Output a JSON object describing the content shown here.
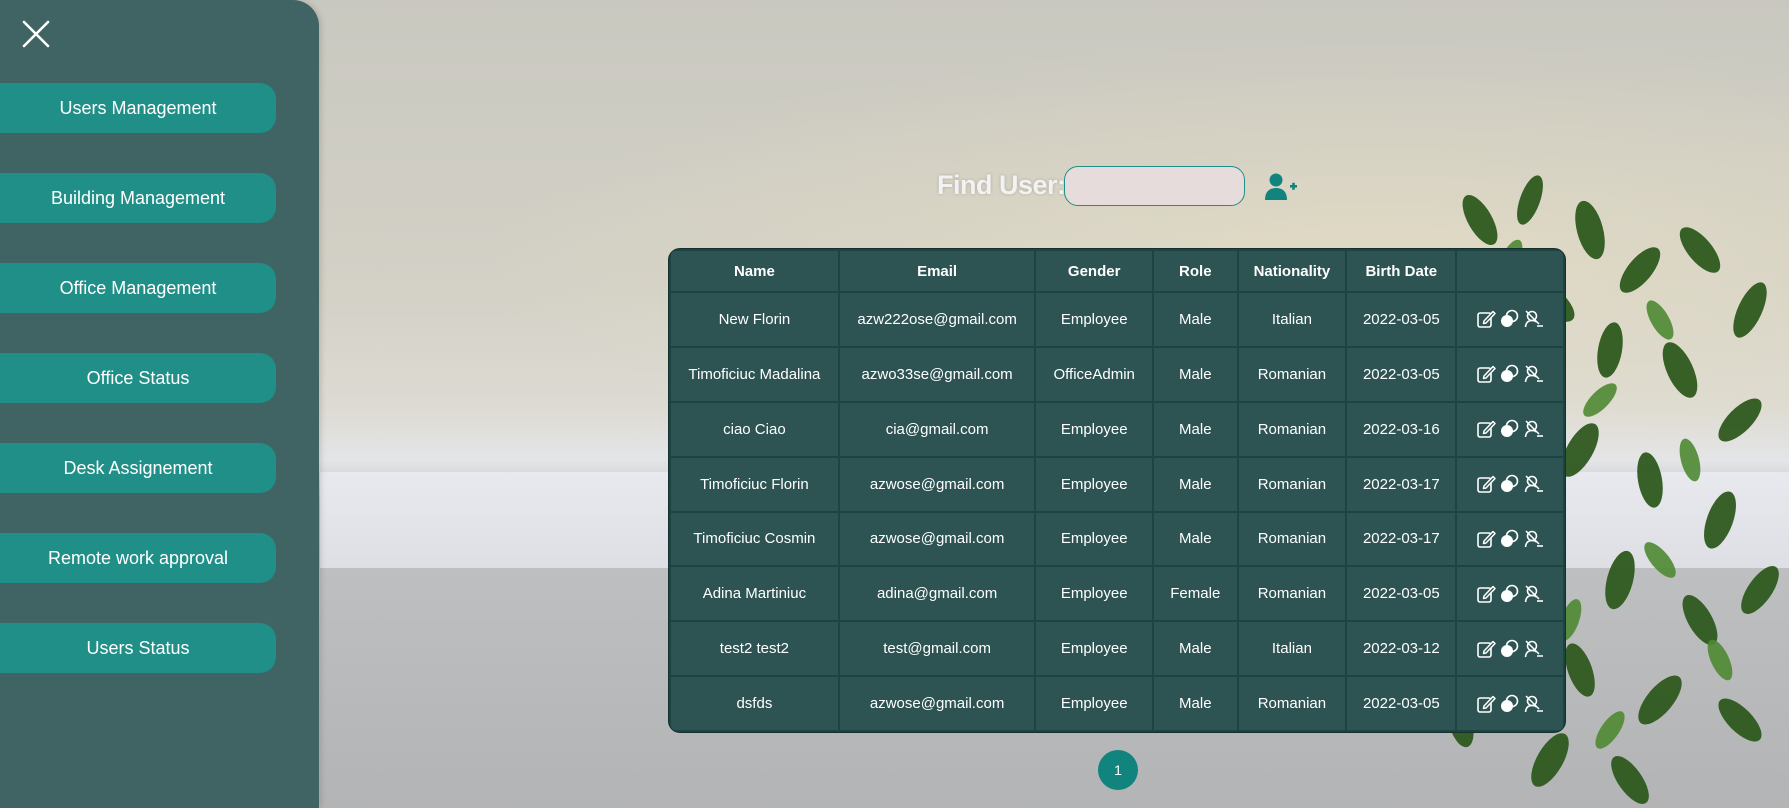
{
  "sidebar": {
    "close_icon": "close-icon",
    "items": [
      {
        "label": "Users Management"
      },
      {
        "label": "Building Management"
      },
      {
        "label": "Office Management"
      },
      {
        "label": "Office Status"
      },
      {
        "label": "Desk Assignement"
      },
      {
        "label": "Remote work approval"
      },
      {
        "label": "Users Status"
      }
    ]
  },
  "search": {
    "label": "Find User:",
    "value": "",
    "placeholder": "",
    "add_icon": "add-user-icon"
  },
  "table": {
    "columns": [
      "Name",
      "Email",
      "Gender",
      "Role",
      "Nationality",
      "Birth Date",
      ""
    ],
    "rows": [
      {
        "name": "New Florin",
        "email": "azw222ose@gmail.com",
        "gender": "Employee",
        "role": "Male",
        "nationality": "Italian",
        "birth_date": "2022-03-05"
      },
      {
        "name": "Timoficiuc Madalina",
        "email": "azwo33se@gmail.com",
        "gender": "OfficeAdmin",
        "role": "Male",
        "nationality": "Romanian",
        "birth_date": "2022-03-05"
      },
      {
        "name": "ciao Ciao",
        "email": "cia@gmail.com",
        "gender": "Employee",
        "role": "Male",
        "nationality": "Romanian",
        "birth_date": "2022-03-16"
      },
      {
        "name": "Timoficiuc Florin",
        "email": "azwose@gmail.com",
        "gender": "Employee",
        "role": "Male",
        "nationality": "Romanian",
        "birth_date": "2022-03-17"
      },
      {
        "name": "Timoficiuc Cosmin",
        "email": "azwose@gmail.com",
        "gender": "Employee",
        "role": "Male",
        "nationality": "Romanian",
        "birth_date": "2022-03-17"
      },
      {
        "name": "Adina Martiniuc",
        "email": "adina@gmail.com",
        "gender": "Employee",
        "role": "Female",
        "nationality": "Romanian",
        "birth_date": "2022-03-05"
      },
      {
        "name": "test2 test2",
        "email": "test@gmail.com",
        "gender": "Employee",
        "role": "Male",
        "nationality": "Italian",
        "birth_date": "2022-03-12"
      },
      {
        "name": "dsfds",
        "email": "azwose@gmail.com",
        "gender": "Employee",
        "role": "Male",
        "nationality": "Romanian",
        "birth_date": "2022-03-05"
      }
    ],
    "row_action_icons": [
      "edit-icon",
      "toggle-icon",
      "user-remove-icon"
    ]
  },
  "pagination": {
    "current_page": "1"
  },
  "colors": {
    "sidebar_bg": "#3f6463",
    "accent": "#1f8f88",
    "table_cell": "#2d5352",
    "input_bg": "#e7dcdc"
  }
}
